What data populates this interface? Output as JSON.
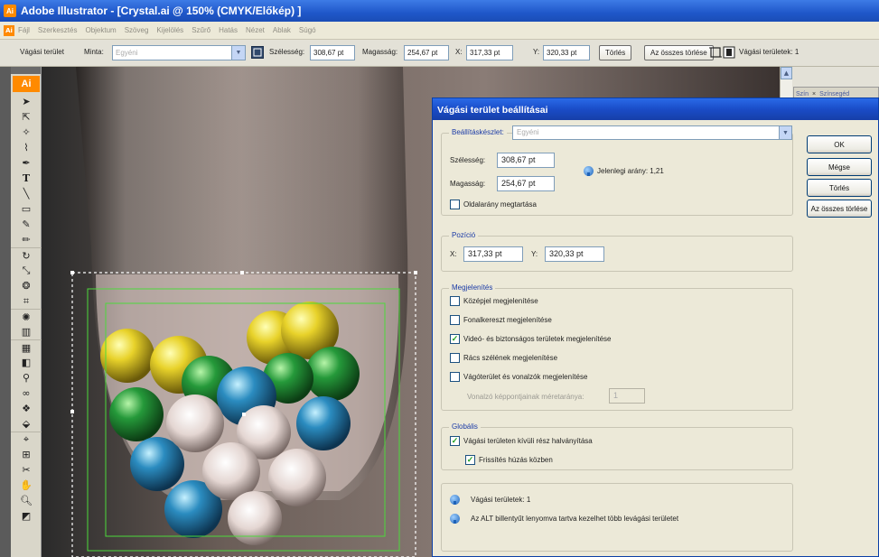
{
  "window": {
    "title": "Adobe Illustrator - [Crystal.ai @ 150% (CMYK/Előkép) ]",
    "app_icon": "Ai"
  },
  "menu": {
    "items": [
      "Fájl",
      "Szerkesztés",
      "Objektum",
      "Szöveg",
      "Kijelölés",
      "Szűrő",
      "Hatás",
      "Nézet",
      "Ablak",
      "Súgó"
    ]
  },
  "control_bar": {
    "label_crop_area": "Vágási terület",
    "label_preset": "Minta:",
    "preset_value": "Egyéni",
    "label_width": "Szélesség:",
    "width_value": "308,67 pt",
    "label_height": "Magasság:",
    "height_value": "254,67 pt",
    "label_x": "X:",
    "x_value": "317,33 pt",
    "label_y": "Y:",
    "y_value": "320,33 pt",
    "delete_button": "Törlés",
    "delete_all_button": "Az összes törlése",
    "crop_areas_count": "Vágási területek: 1"
  },
  "toolbar": {
    "logo": "Ai"
  },
  "side_panel": {
    "tabs": [
      "Szín",
      "Színsegéd"
    ]
  },
  "dialog": {
    "title": "Vágási terület beállításai",
    "settings": {
      "group_label": "Beállításkészlet:",
      "preset_value": "Egyéni",
      "width_label": "Szélesség:",
      "width_value": "308,67 pt",
      "height_label": "Magasság:",
      "height_value": "254,67 pt",
      "ratio_text": "Jelenlegi arány: 1,21",
      "keep_ratio": "Oldalarány megtartása",
      "keep_ratio_checked": false
    },
    "position": {
      "group_label": "Pozíció",
      "x_label": "X:",
      "x_value": "317,33 pt",
      "y_label": "Y:",
      "y_value": "320,33 pt"
    },
    "display": {
      "group_label": "Megjelenítés",
      "opt_center": "Középjel megjelenítése",
      "opt_crosshair": "Fonalkereszt megjelenítése",
      "opt_video": "Videó- és biztonságos területek megjelenítése",
      "opt_grid": "Rács szélének megjelenítése",
      "opt_cropmarks": "Vágóterület és vonalzók megjelenítése",
      "pixel_ratio_label": "Vonalzó képpontjainak méretaránya:",
      "pixel_ratio_value": "1"
    },
    "global": {
      "group_label": "Globális",
      "opt_dim": "Vágási területen kívüli rész halványítása",
      "opt_refresh": "Frissítés húzás közben"
    },
    "info": {
      "count_text": "Vágási területek: 1",
      "alt_text": "Az ALT billentyűt lenyomva tartva kezelhet több levágási területet"
    },
    "buttons": {
      "ok": "OK",
      "cancel": "Mégse",
      "delete": "Törlés",
      "delete_all": "Az összes törlése"
    }
  }
}
